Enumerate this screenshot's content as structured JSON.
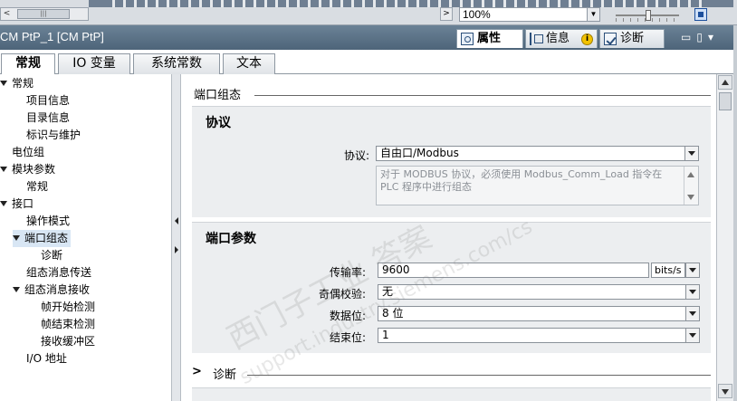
{
  "toolbar": {
    "hscroll_left": "<",
    "hscroll_thumb": "|||",
    "hscroll_right": ">",
    "zoom_value": "100%",
    "zoom_dropdown": "▼"
  },
  "header": {
    "title": "CM PtP_1 [CM PtP]",
    "tabs": [
      {
        "label": "属性"
      },
      {
        "label": "信息"
      },
      {
        "label": "诊断"
      }
    ],
    "info_badge": "i",
    "window_controls": "▭▯▾"
  },
  "main_tabs": [
    {
      "label": "常规"
    },
    {
      "label": "IO 变量"
    },
    {
      "label": "系统常数"
    },
    {
      "label": "文本"
    }
  ],
  "tree": [
    {
      "label": "常规"
    },
    {
      "label": "项目信息"
    },
    {
      "label": "目录信息"
    },
    {
      "label": "标识与维护"
    },
    {
      "label": "电位组"
    },
    {
      "label": "模块参数"
    },
    {
      "label": "常规"
    },
    {
      "label": "接口"
    },
    {
      "label": "操作模式"
    },
    {
      "label": "端口组态"
    },
    {
      "label": "诊断"
    },
    {
      "label": "组态消息传送"
    },
    {
      "label": "组态消息接收"
    },
    {
      "label": "帧开始检测"
    },
    {
      "label": "帧结束检测"
    },
    {
      "label": "接收缓冲区"
    },
    {
      "label": "I/O 地址"
    }
  ],
  "content": {
    "section_port_config": "端口组态",
    "protocol_panel": {
      "title": "协议",
      "protocol_label": "协议:",
      "protocol_value": "自由口/Modbus",
      "note": "对于 MODBUS 协议，必须使用 Modbus_Comm_Load 指令在 PLC 程序中进行组态"
    },
    "port_params_panel": {
      "title": "端口参数",
      "baud_label": "传输率:",
      "baud_value": "9600",
      "baud_unit": "bits/s",
      "parity_label": "奇偶校验:",
      "parity_value": "无",
      "databits_label": "数据位:",
      "databits_value": "8 位",
      "stopbits_label": "结束位:",
      "stopbits_value": "1"
    },
    "section_diag": "诊断",
    "section_diag_chevron": ">"
  },
  "watermark": {
    "line1": "西门子工业 答案",
    "line2": "support.industry.siemens.com/cs"
  }
}
